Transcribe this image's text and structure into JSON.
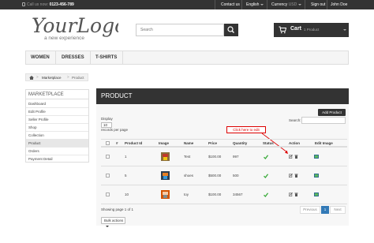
{
  "topbar": {
    "call_label": "Call us now:",
    "phone": "0123-456-789",
    "contact": "Contact us",
    "language": "English",
    "currency_label": "Currency",
    "currency_value": "USD",
    "signout": "Sign out",
    "user": "John Doe"
  },
  "logo": {
    "text": "YourLogo",
    "tagline": "a new experience"
  },
  "search": {
    "placeholder": "Search"
  },
  "cart": {
    "label": "Cart",
    "count": "1 Product"
  },
  "nav": {
    "items": [
      "WOMEN",
      "DRESSES",
      "T-SHIRTS"
    ]
  },
  "breadcrumb": {
    "section": "Marketplace",
    "page": "Product"
  },
  "sidebar": {
    "title": "MARKETPLACE",
    "items": [
      "Dashboard",
      "Edit Profile",
      "Seller Profile",
      "Shop",
      "Collection",
      "Product",
      "Orders",
      "Payment Detail"
    ],
    "active_index": 5
  },
  "main": {
    "title": "PRODUCT",
    "add_button": "Add Product",
    "display_label": "Display",
    "per_page_value": "10",
    "per_page_suffix": "records per page",
    "search_label": "Search:",
    "callout": "Click here to edit",
    "columns": [
      "#",
      "Product Id",
      "Image",
      "Name",
      "Price",
      "Quantity",
      "Status",
      "Action",
      "Edit Image"
    ],
    "rows": [
      {
        "id": "1",
        "name": "Test",
        "price": "$100.00",
        "qty": "997",
        "thumb": [
          "#8a6d3b",
          "#c0392b",
          "#f1c40f"
        ]
      },
      {
        "id": "5",
        "name": "shoes",
        "price": "$500.00",
        "qty": "500",
        "thumb": [
          "#2c3e50",
          "#e67e22",
          "#3498db"
        ]
      },
      {
        "id": "10",
        "name": "toy",
        "price": "$100.00",
        "qty": "34567",
        "thumb": [
          "#d35400",
          "#f5cba7",
          "#7f8c8d"
        ]
      }
    ],
    "showing": "Showing page 1 of 1",
    "pagination": {
      "previous": "Previous",
      "current": "1",
      "next": "Next"
    },
    "bulk_actions": "Bulk actions"
  },
  "colors": {
    "dark": "#333333",
    "accent": "#337ab7",
    "status_ok": "#3bab3b",
    "callout": "#dd0000"
  }
}
